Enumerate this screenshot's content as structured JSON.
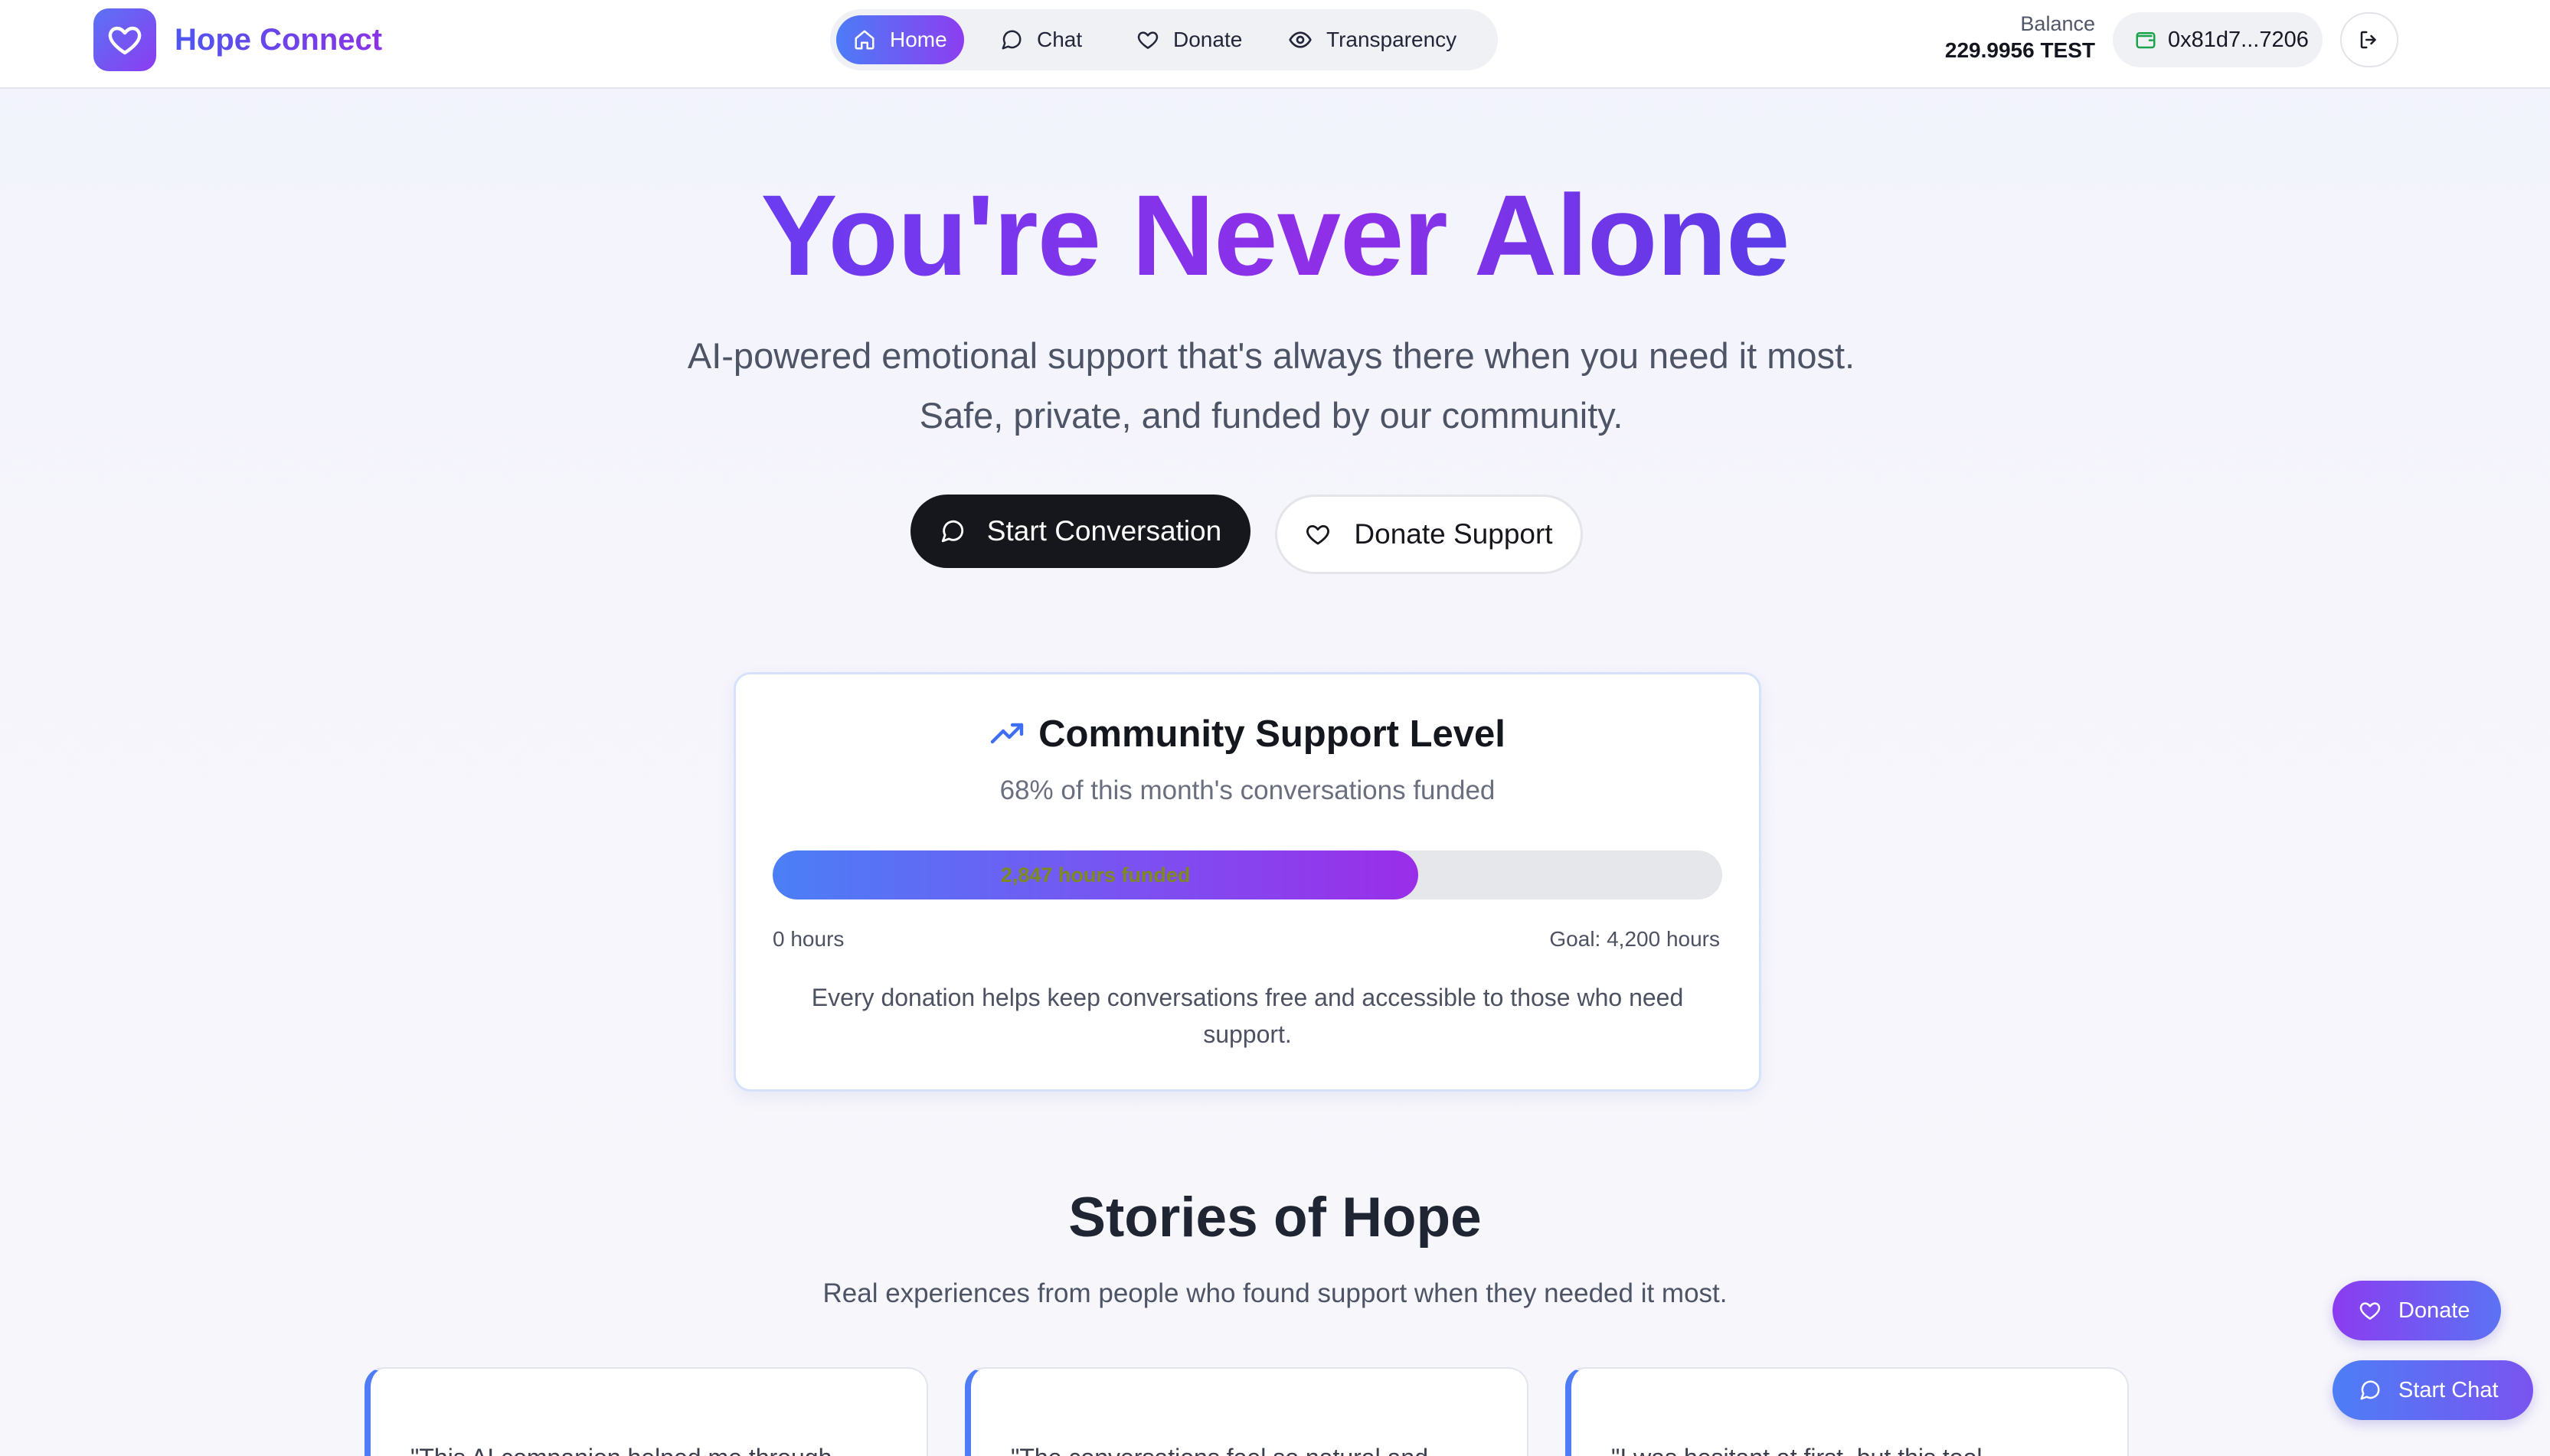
{
  "brand": {
    "name": "Hope Connect",
    "logo_icon": "heart-icon"
  },
  "nav": {
    "items": [
      {
        "label": "Home",
        "icon": "home-icon",
        "active": true
      },
      {
        "label": "Chat",
        "icon": "chat-bubble-icon",
        "active": false
      },
      {
        "label": "Donate",
        "icon": "heart-icon",
        "active": false
      },
      {
        "label": "Transparency",
        "icon": "eye-icon",
        "active": false
      }
    ]
  },
  "account": {
    "balance_label": "Balance",
    "balance_value": "229.9956 TEST",
    "wallet_address": "0x81d7...7206",
    "wallet_icon": "wallet-icon",
    "logout_icon": "logout-icon"
  },
  "hero": {
    "title": "You're Never Alone",
    "subtitle": "AI-powered emotional support that's always there when you need it most. Safe, private, and funded by our community.",
    "primary_cta": "Start Conversation",
    "secondary_cta": "Donate Support"
  },
  "support": {
    "title": "Community Support Level",
    "title_icon": "trending-up-icon",
    "subtitle": "68% of this month's conversations funded",
    "progress_fraction": 0.68,
    "progress_label": "2,847 hours funded",
    "scale_min": "0 hours",
    "scale_max": "Goal: 4,200 hours",
    "note": "Every donation helps keep conversations free and accessible to those who need support."
  },
  "stories": {
    "title": "Stories of Hope",
    "subtitle": "Real experiences from people who found support when they needed it most.",
    "cards": [
      {
        "quote": "\"This AI companion helped me through"
      },
      {
        "quote": "\"The conversations feel so natural and"
      },
      {
        "quote": "\"I was hesitant at first, but this tool"
      }
    ]
  },
  "floating": {
    "donate_label": "Donate",
    "chat_label": "Start Chat"
  },
  "colors": {
    "accent_blue": "#4c7cf6",
    "accent_purple": "#8c3ef0",
    "primary_button": "#16171c",
    "progress_track": "#e6e7ea"
  }
}
